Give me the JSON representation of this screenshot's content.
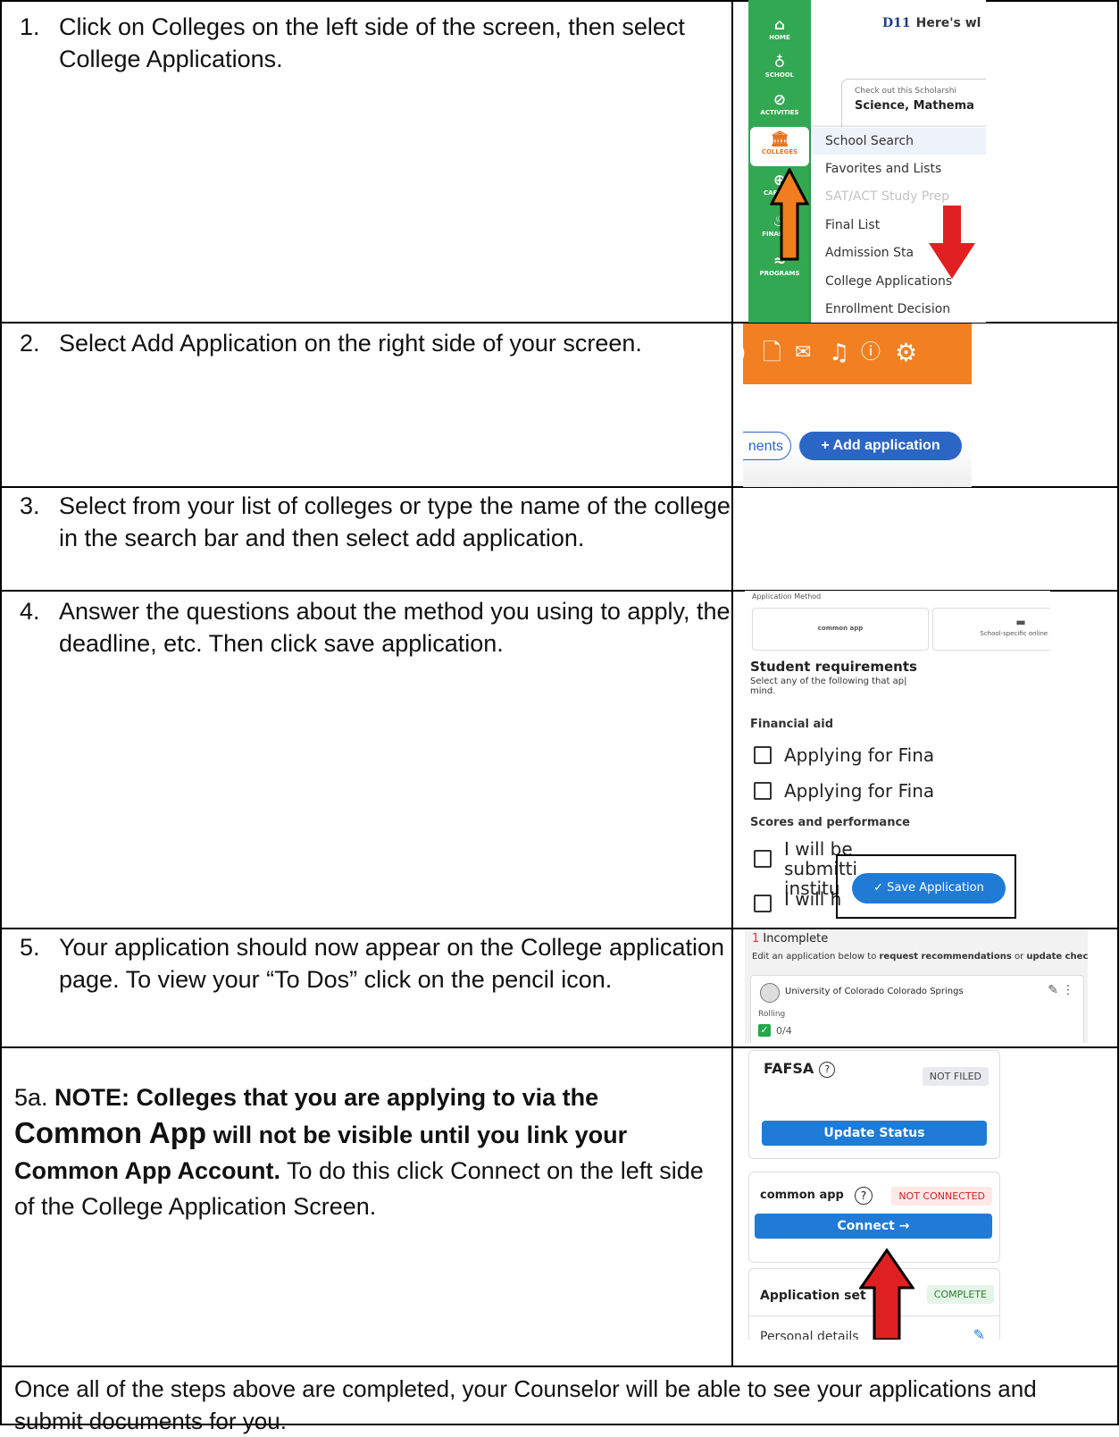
{
  "steps": [
    {
      "num": "1.",
      "text": "Click on Colleges on the left side of the screen, then select College Applications."
    },
    {
      "num": "2.",
      "text": "Select Add Application on the right side of your screen."
    },
    {
      "num": "3.",
      "text": "Select from your list of colleges or type the name of the college in the search bar and then select add application."
    },
    {
      "num": "4.",
      "text": "Answer the questions about the method you using to apply, the deadline, etc. Then click save application."
    },
    {
      "num": "5.",
      "text": "Your application should now appear on the College application page. To view your “To Dos” click on the pencil icon."
    }
  ],
  "note": {
    "prefix": "5a. ",
    "bold1": "NOTE: Colleges that you are applying to via the ",
    "bold_big": "Common App",
    "bold2": " will not be visible until you link your Common App Account.",
    "rest": " To do this click Connect on the left side of the College Application Screen."
  },
  "footer": "Once all of the steps above are completed, your Counselor will be able to see your applications and submit documents for you.",
  "shot1": {
    "header": "Here's wl",
    "logo": "D11",
    "card_line1": "Check out this Scholarshi",
    "card_line2": "Science, Mathema",
    "rail": [
      "HOME",
      "SCHOOL",
      "ACTIVITIES",
      "COLLEGES",
      "CAREERS",
      "FINANCES",
      "PROGRAMS"
    ],
    "menu": [
      "School Search",
      "Favorites and Lists",
      "SAT/ACT Study Prep",
      "Final List",
      "Admission Sta",
      "College Applications",
      "Enrollment Decision"
    ]
  },
  "shot2": {
    "pill1": "nents",
    "pill2": "+ Add application"
  },
  "shot4": {
    "caption": "Application Method",
    "opt1": "common app",
    "opt2": "School-specific online app",
    "h1": "Student requirements",
    "sub_text": "Select any of the following that ap| mind.",
    "fin": "Financial aid",
    "cb1": "Applying for Fina",
    "cb2": "Applying for Fina",
    "scores": "Scores and performance",
    "cb3": "I will be submitti institu",
    "cb4": "I will h",
    "save": "✓ Save Application"
  },
  "shot5": {
    "count": "1",
    "status": "Incomplete",
    "hint_pre": "Edit an application below to ",
    "hint_b1": "request recommendations",
    "hint_mid": " or ",
    "hint_b2": "update checklist",
    "hint_end": ".",
    "university": "University of Colorado Colorado Springs",
    "rolling": "Rolling",
    "progress": "0/4"
  },
  "shot6": {
    "fafsa": "FAFSA",
    "not_filed": "NOT FILED",
    "update": "Update Status",
    "common_app": "common app",
    "not_connected": "NOT CONNECTED",
    "connect": "Connect →",
    "app_setup": "Application set",
    "complete": "COMPLETE",
    "personal": "Personal details"
  },
  "colors": {
    "green_rail": "#32a852",
    "orange_bar": "#f28022",
    "blue_button": "#1f7bd6",
    "red_arrow": "#e02020",
    "orange_arrow": "#f07d1e"
  }
}
